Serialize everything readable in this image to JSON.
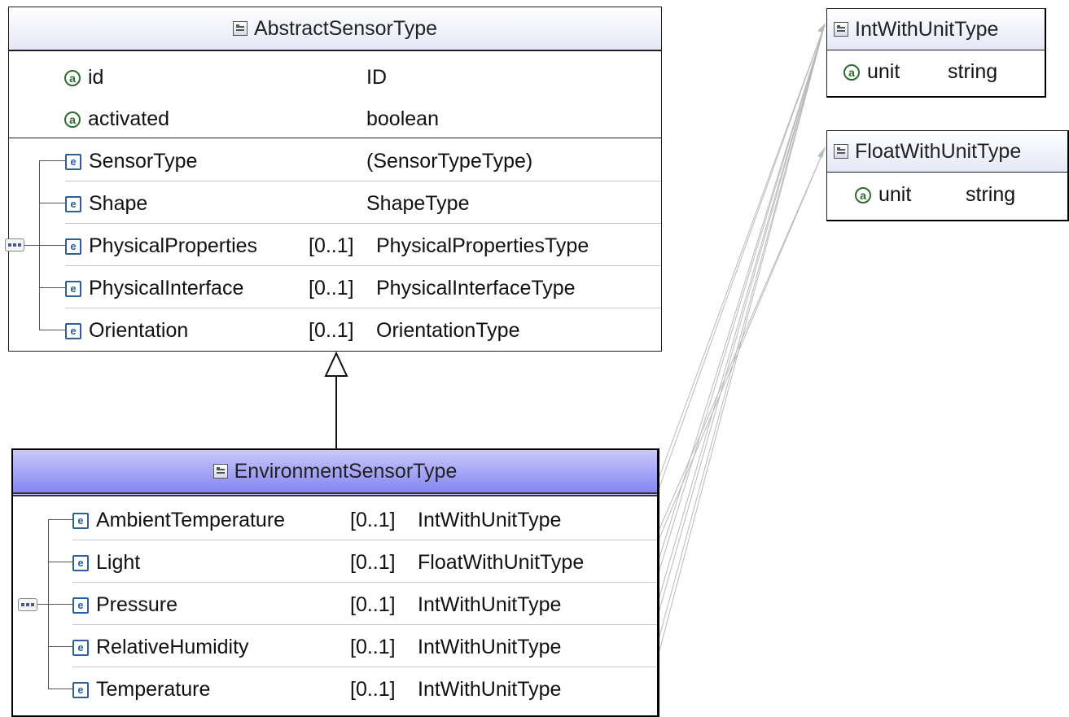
{
  "abstract_type": {
    "name": "AbstractSensorType",
    "attributes": [
      {
        "name": "id",
        "type": "ID"
      },
      {
        "name": "activated",
        "type": "boolean"
      }
    ],
    "elements": [
      {
        "name": "SensorType",
        "occurs": "",
        "type": "(SensorTypeType)"
      },
      {
        "name": "Shape",
        "occurs": "",
        "type": "ShapeType"
      },
      {
        "name": "PhysicalProperties",
        "occurs": "[0..1]",
        "type": "PhysicalPropertiesType"
      },
      {
        "name": "PhysicalInterface",
        "occurs": "[0..1]",
        "type": "PhysicalInterfaceType"
      },
      {
        "name": "Orientation",
        "occurs": "[0..1]",
        "type": "OrientationType"
      }
    ]
  },
  "derived_type": {
    "name": "EnvironmentSensorType",
    "elements": [
      {
        "name": "AmbientTemperature",
        "occurs": "[0..1]",
        "type": "IntWithUnitType"
      },
      {
        "name": "Light",
        "occurs": "[0..1]",
        "type": "FloatWithUnitType"
      },
      {
        "name": "Pressure",
        "occurs": "[0..1]",
        "type": "IntWithUnitType"
      },
      {
        "name": "RelativeHumidity",
        "occurs": "[0..1]",
        "type": "IntWithUnitType"
      },
      {
        "name": "Temperature",
        "occurs": "[0..1]",
        "type": "IntWithUnitType"
      }
    ]
  },
  "int_with_unit": {
    "name": "IntWithUnitType",
    "attributes": [
      {
        "name": "unit",
        "type": "string"
      }
    ]
  },
  "float_with_unit": {
    "name": "FloatWithUnitType",
    "attributes": [
      {
        "name": "unit",
        "type": "string"
      }
    ]
  },
  "icons": {
    "attribute": "attribute-icon",
    "element": "element-icon",
    "complex_type": "complex-type-icon",
    "sequence": "sequence-compositor-icon"
  },
  "colors": {
    "derived_header": "#8585f1",
    "attribute_icon": "#2e6b2e",
    "element_icon": "#2d5f9a"
  }
}
